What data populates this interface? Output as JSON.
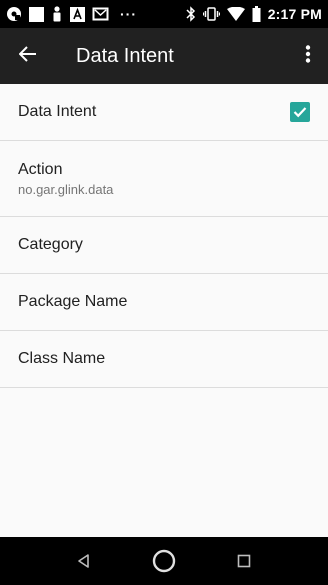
{
  "status_bar": {
    "time": "2:17 PM",
    "left_icons": [
      "chat-notification-icon",
      "square-notification-icon",
      "person-notification-icon",
      "a-box-notification-icon",
      "gmail-notification-icon"
    ],
    "overflow_dots": "···",
    "right_icons": [
      "bluetooth-icon",
      "vibrate-icon",
      "wifi-icon",
      "battery-icon"
    ]
  },
  "app_bar": {
    "title": "Data Intent",
    "back_icon": "back-arrow-icon",
    "overflow_icon": "more-vert-icon"
  },
  "preferences": [
    {
      "title": "Data Intent",
      "summary": "",
      "checked": true,
      "accent": "#26a69a"
    },
    {
      "title": "Action",
      "summary": "no.gar.glink.data"
    },
    {
      "title": "Category",
      "summary": ""
    },
    {
      "title": "Package Name",
      "summary": ""
    },
    {
      "title": "Class Name",
      "summary": ""
    }
  ],
  "nav_bar": {
    "buttons": [
      "back-triangle-icon",
      "home-circle-icon",
      "recents-square-icon"
    ]
  },
  "colors": {
    "status_bar": "#000000",
    "app_bar": "#212121",
    "background": "#fafafa",
    "accent": "#26a69a"
  }
}
